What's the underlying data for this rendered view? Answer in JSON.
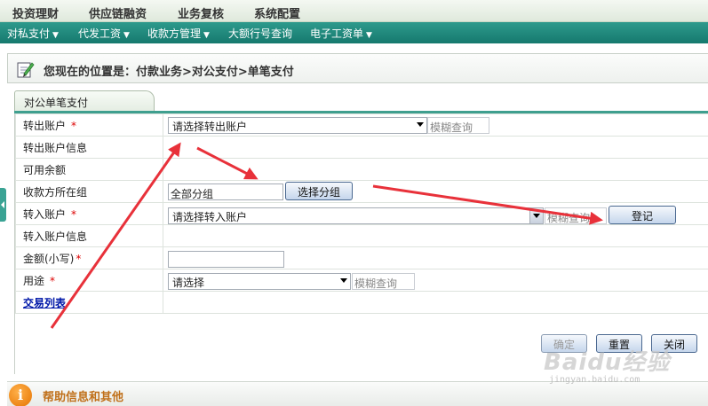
{
  "top_menu": [
    "投资理财",
    "供应链融资",
    "业务复核",
    "系统配置"
  ],
  "sub_menu": [
    "对私支付",
    "代发工资",
    "收款方管理",
    "大额行号查询",
    "电子工资单"
  ],
  "breadcrumb": "您现在的位置是：付款业务>对公支付>单笔支付",
  "tab": "对公单笔支付",
  "form": {
    "out_account_label": "转出账户",
    "out_account_placeholder": "请选择转出账户",
    "fuzzy_query": "模糊查询",
    "out_account_info_label": "转出账户信息",
    "available_balance_label": "可用余额",
    "payee_group_label": "收款方所在组",
    "payee_group_value": "全部分组",
    "select_group_button": "选择分组",
    "in_account_label": "转入账户",
    "in_account_placeholder": "请选择转入账户",
    "fuzzy_query_partial": "模糊查询",
    "register_button": "登记",
    "in_account_info_label": "转入账户信息",
    "amount_label": "金额(小写)",
    "purpose_label": "用途",
    "purpose_placeholder": "请选择",
    "transaction_list_link": "交易列表",
    "required_mark": "*"
  },
  "actions": {
    "confirm": "确定",
    "reset": "重置",
    "close": "关闭"
  },
  "help": "帮助信息和其他",
  "watermark": {
    "title": "Baidu经验",
    "url": "jingyan.baidu.com"
  },
  "colors": {
    "submenu_bg": "#16796e",
    "arrow": "#e8313a",
    "required": "#dd0000",
    "link": "#0018a8"
  }
}
